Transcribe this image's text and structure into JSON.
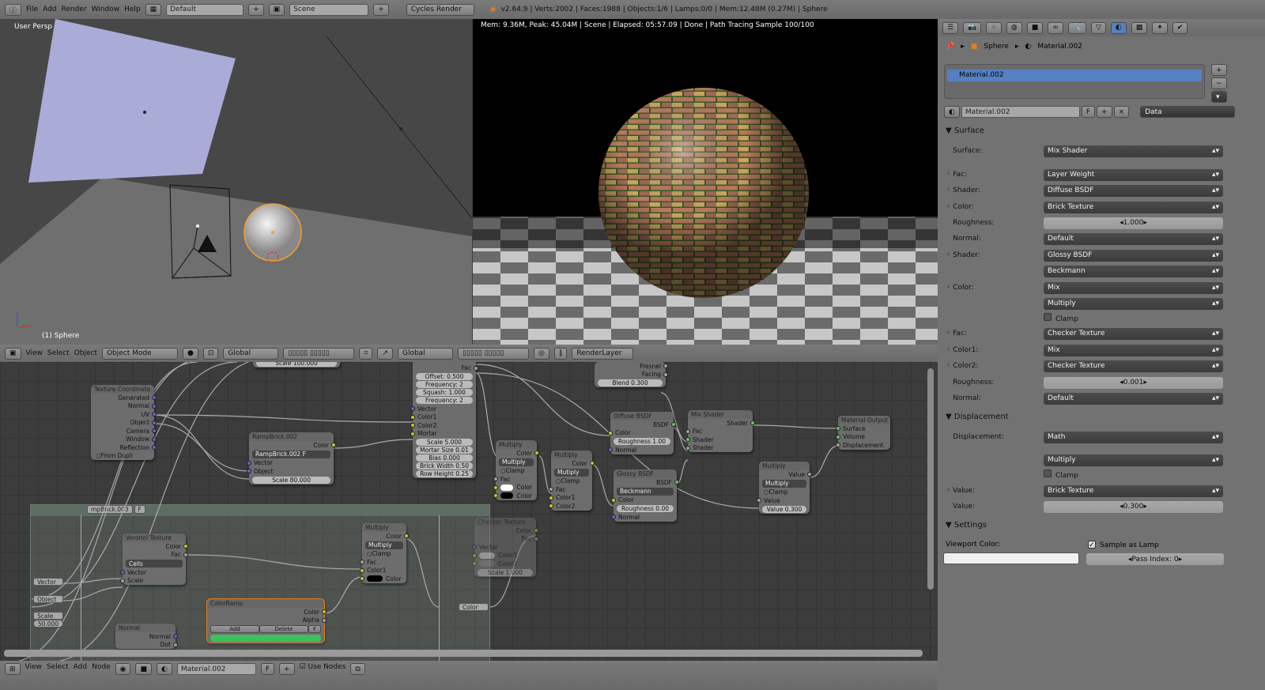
{
  "topbar": {
    "menus": [
      "File",
      "Add",
      "Render",
      "Window",
      "Help"
    ],
    "layout": "Default",
    "scene": "Scene",
    "engine": "Cycles Render",
    "stats": "v2.64.9 | Verts:2002 | Faces:1988 | Objects:1/6 | Lamps:0/0 | Mem:12.48M (0.27M) | Sphere"
  },
  "viewport": {
    "label": "User Persp",
    "object": "(1) Sphere",
    "colors": {
      "plane": "#a9acd6",
      "selected": "#f0a030"
    }
  },
  "render": {
    "status": "Mem: 9.36M, Peak: 45.04M | Scene | Elapsed: 05:57.09 | Done | Path Tracing Sample 100/100"
  },
  "view3d_header": {
    "menus": [
      "View",
      "Select",
      "Object"
    ],
    "mode": "Object Mode",
    "orientation": "Global",
    "orientation2": "Global",
    "render_layer": "RenderLayer"
  },
  "node_header": {
    "menus": [
      "View",
      "Select",
      "Add",
      "Node"
    ],
    "material": "Material.002",
    "fake": "F",
    "use_nodes": "Use Nodes"
  },
  "nodes": [
    {
      "title": "",
      "rows": [
        [
          "fld",
          "Scale 100.000"
        ]
      ]
    },
    {
      "title": "Texture Coordinate",
      "rows": [
        [
          "out",
          "Generated",
          "b"
        ],
        [
          "out",
          "Normal",
          "b"
        ],
        [
          "out",
          "UV",
          "b"
        ],
        [
          "out",
          "Object",
          "b"
        ],
        [
          "out",
          "Camera",
          "b"
        ],
        [
          "out",
          "Window",
          "b"
        ],
        [
          "out",
          "Reflection",
          "b"
        ],
        [
          "chk",
          "From Dupli"
        ]
      ]
    },
    {
      "title": "RampBrick.002",
      "rows": [
        [
          "out",
          "Color",
          "y"
        ],
        [
          "sel",
          "RampBrick.002   F"
        ],
        [
          "in",
          "Vector",
          "b"
        ],
        [
          "in",
          "Object",
          "b"
        ],
        [
          "fld",
          "Scale 80.000"
        ]
      ]
    },
    {
      "title": "",
      "rows": [
        [
          "out",
          "Color",
          "y"
        ],
        [
          "out",
          "Fac",
          "g"
        ],
        [
          "fld",
          "Offset: 0.500"
        ],
        [
          "fld",
          "Frequency: 2"
        ],
        [
          "fld",
          "Squash: 1.000"
        ],
        [
          "fld",
          "Frequency: 2"
        ],
        [
          "in",
          "Vector",
          "b"
        ],
        [
          "in",
          "Color1",
          "y"
        ],
        [
          "in",
          "Color2",
          "y"
        ],
        [
          "in",
          "Mortar",
          "y"
        ],
        [
          "fld",
          "Scale 5.000"
        ],
        [
          "fld",
          "Mortar Size 0.01"
        ],
        [
          "fld",
          "Bias 0.000"
        ],
        [
          "fld",
          "Brick Width 0.50"
        ],
        [
          "fld",
          "Row Height 0.25"
        ]
      ]
    },
    {
      "title": "",
      "rows": [
        [
          "out",
          "Fresnel",
          "g"
        ],
        [
          "out",
          "Facing",
          "g"
        ],
        [
          "fld",
          "Blend 0.300"
        ]
      ]
    },
    {
      "title": "Multiply",
      "rows": [
        [
          "out",
          "Color",
          "y"
        ],
        [
          "sel",
          "Multiply"
        ],
        [
          "chk",
          "Clamp"
        ],
        [
          "in",
          "Fac",
          "g"
        ],
        [
          "swin",
          "Color",
          "#ffffff"
        ],
        [
          "swin",
          "Color",
          "#000000"
        ]
      ]
    },
    {
      "title": "Multiply",
      "rows": [
        [
          "out",
          "Color",
          "y"
        ],
        [
          "sel",
          "Mutiply"
        ],
        [
          "chk",
          "Clamp"
        ],
        [
          "in",
          "Fac",
          "g"
        ],
        [
          "in",
          "Color1",
          "y"
        ],
        [
          "in",
          "Color2",
          "y"
        ]
      ]
    },
    {
      "title": "Diffuse BSDF",
      "rows": [
        [
          "out",
          "BSDF",
          "G"
        ],
        [
          "in",
          "Color",
          "y"
        ],
        [
          "fld",
          "Roughness 1.00"
        ],
        [
          "in",
          "Normal",
          "b"
        ]
      ]
    },
    {
      "title": "Glossy BSDF",
      "rows": [
        [
          "out",
          "BSDF",
          "G"
        ],
        [
          "sel",
          "Beckmann"
        ],
        [
          "in",
          "Color",
          "y"
        ],
        [
          "fld",
          "Roughness 0.00"
        ],
        [
          "in",
          "Normal",
          "b"
        ]
      ]
    },
    {
      "title": "Mix Shader",
      "rows": [
        [
          "out",
          "Shader",
          "G"
        ],
        [
          "in",
          "Fac",
          "g"
        ],
        [
          "in",
          "Shader",
          "G"
        ],
        [
          "in",
          "Shader",
          "G"
        ]
      ]
    },
    {
      "title": "Material Output",
      "rows": [
        [
          "in",
          "Surface",
          "G"
        ],
        [
          "in",
          "Volume",
          "G"
        ],
        [
          "in",
          "Displacement",
          "g"
        ]
      ]
    },
    {
      "title": "Multiply",
      "rows": [
        [
          "out",
          "Value",
          "g"
        ],
        [
          "sel",
          "Multiply"
        ],
        [
          "chk",
          "Clamp"
        ],
        [
          "in",
          "Value",
          "g"
        ],
        [
          "fld",
          "Value 0.300"
        ]
      ]
    },
    {
      "title": "Voronoi Texture",
      "rows": [
        [
          "out",
          "Color",
          "y"
        ],
        [
          "out",
          "Fac",
          "g"
        ],
        [
          "sel",
          "Cells"
        ],
        [
          "in",
          "Vector",
          "b"
        ],
        [
          "in",
          "Scale",
          "g"
        ]
      ]
    },
    {
      "title": "Multiply",
      "rows": [
        [
          "out",
          "Color",
          "y"
        ],
        [
          "sel",
          "Multiply"
        ],
        [
          "chk",
          "Clamp"
        ],
        [
          "in",
          "Fac",
          "g"
        ],
        [
          "in",
          "Color1",
          "y"
        ],
        [
          "swin",
          "Color",
          "#000000"
        ]
      ]
    },
    {
      "title": "ColorRamp",
      "rows": [
        [
          "out",
          "Color",
          "y"
        ],
        [
          "out",
          "Alpha",
          "g"
        ],
        [
          "btns",
          "Add|Delete|F"
        ],
        [
          "ramp",
          ""
        ]
      ]
    },
    {
      "title": "Normal",
      "rows": [
        [
          "out",
          "Normal",
          "b"
        ],
        [
          "out",
          "Dot",
          "g"
        ]
      ]
    },
    {
      "title": "Checker Texture",
      "rows": [
        [
          "out",
          "Color",
          "y"
        ],
        [
          "out",
          "Fac",
          "g"
        ],
        [
          "in",
          "Vector",
          "b"
        ],
        [
          "swin",
          "Color1",
          "#cccccc"
        ],
        [
          "swin",
          "Color2",
          "#888888"
        ],
        [
          "fld",
          "Scale 1.000"
        ]
      ]
    }
  ],
  "group": {
    "name": "mpBrick.003",
    "fake": "F",
    "inputs": [
      "Vector",
      "Object",
      "Scale"
    ],
    "scale_value": "50.000",
    "output": "Color"
  },
  "properties": {
    "breadcrumb": [
      "Sphere",
      "Material.002"
    ],
    "slot": "Material.002",
    "material": "Material.002",
    "fake": "F",
    "link": "Data",
    "sections": {
      "surface": "Surface",
      "displacement": "Displacement",
      "settings": "Settings"
    },
    "surface_rows": [
      {
        "label": "Surface:",
        "value": "Mix Shader",
        "type": "menu"
      },
      {
        "label": "Fac:",
        "value": "Layer Weight",
        "type": "menu",
        "dot": true
      },
      {
        "label": "Shader:",
        "value": "Diffuse BSDF",
        "type": "menu",
        "dot": true
      },
      {
        "label": "Color:",
        "value": "Brick Texture",
        "type": "menu",
        "dot": true
      },
      {
        "label": "Roughness:",
        "value": "1.000",
        "type": "slider"
      },
      {
        "label": "Normal:",
        "value": "Default",
        "type": "menu"
      },
      {
        "label": "Shader:",
        "value": "Glossy BSDF",
        "type": "menu",
        "dot": true
      },
      {
        "label": "",
        "value": "Beckmann",
        "type": "menu"
      },
      {
        "label": "Color:",
        "value": "Mix",
        "type": "menu",
        "dot": true
      },
      {
        "label": "",
        "value": "Multiply",
        "type": "menu"
      },
      {
        "label": "",
        "value": "Clamp",
        "type": "check"
      },
      {
        "label": "Fac:",
        "value": "Checker Texture",
        "type": "menu",
        "dot": true
      },
      {
        "label": "Color1:",
        "value": "Mix",
        "type": "menu",
        "dot": true
      },
      {
        "label": "Color2:",
        "value": "Checker Texture",
        "type": "menu",
        "dot": true
      },
      {
        "label": "Roughness:",
        "value": "0.001",
        "type": "slider"
      },
      {
        "label": "Normal:",
        "value": "Default",
        "type": "menu"
      }
    ],
    "displacement_rows": [
      {
        "label": "Displacement:",
        "value": "Math",
        "type": "menu"
      },
      {
        "label": "",
        "value": "Multiply",
        "type": "menu"
      },
      {
        "label": "",
        "value": "Clamp",
        "type": "check"
      },
      {
        "label": "Value:",
        "value": "Brick Texture",
        "type": "menu",
        "dot": true
      },
      {
        "label": "Value:",
        "value": "0.300",
        "type": "slider"
      }
    ],
    "settings": {
      "viewport_color_label": "Viewport Color:",
      "sample_as_lamp": "Sample as Lamp",
      "sample_as_lamp_checked": true,
      "pass_index": "Pass Index: 0",
      "viewport_color": "#f0f0f0"
    },
    "active_tab": "material-tab",
    "accent": "#5680c2"
  }
}
